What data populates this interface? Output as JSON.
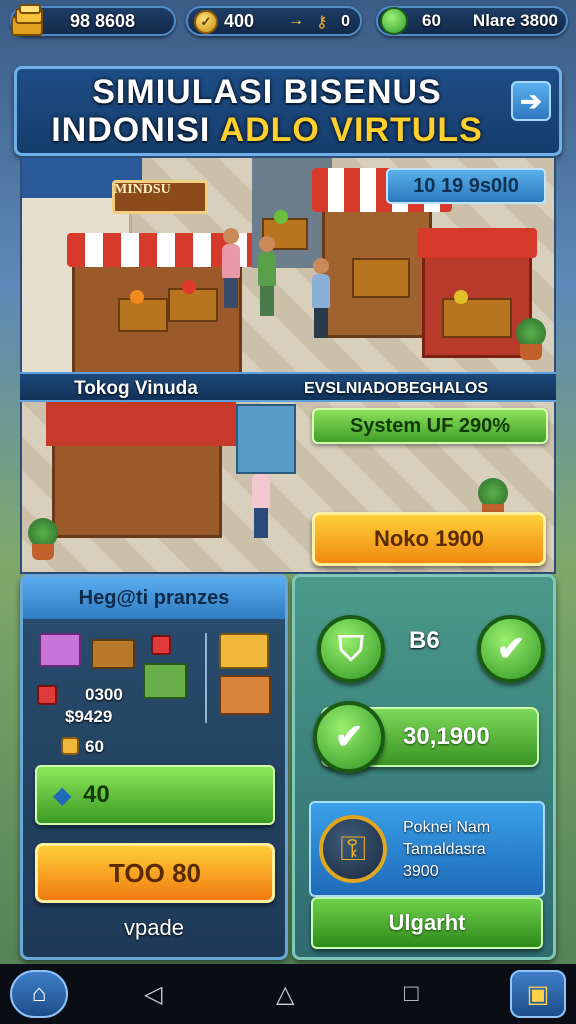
{
  "resources": {
    "coins": "98 8608",
    "gems": "400",
    "gems_extra": "0",
    "energy": "60",
    "energy_extra": "Nlare 3800"
  },
  "title": {
    "line1": "SIMIULASI BISENUS",
    "line2_white": "INDONISI ",
    "line2_gold": "ADLO VIRTULS"
  },
  "scene": {
    "sign_text": "MINDSU",
    "badge": "10 19 9s0l0",
    "label_left": "Tokog Vinuda",
    "label_right": "EVSLNIADOBEGHALOS",
    "system_pill": "System UF 290%",
    "orange_pill": "Noko 1900"
  },
  "left_panel": {
    "header": "Heg@ti pranzes",
    "price_a": "0300",
    "price_b": "$9429",
    "coin_value": "60",
    "green_button": "40",
    "orange_button": "TOO 80",
    "footer": "vpade"
  },
  "right_panel": {
    "b6": "B6",
    "value_pill": "30,1900",
    "info_line1": "Poknei Nam",
    "info_line2": "Tamaldasra",
    "info_line3": "3900",
    "upgrade_button": "Ulgarht"
  },
  "colors": {
    "accent_blue": "#2f7ac0",
    "accent_green": "#3d9a24",
    "accent_orange": "#f07a10",
    "gold": "#ffcf2e"
  },
  "icons": [
    "coin-stack-icon",
    "gem-coin-icon",
    "key-icon",
    "energy-orb-icon",
    "arrow-right-icon",
    "shield-icon",
    "check-icon",
    "key-gear-icon",
    "home-icon",
    "back-icon",
    "recent-apps-icon",
    "menu-icon"
  ]
}
